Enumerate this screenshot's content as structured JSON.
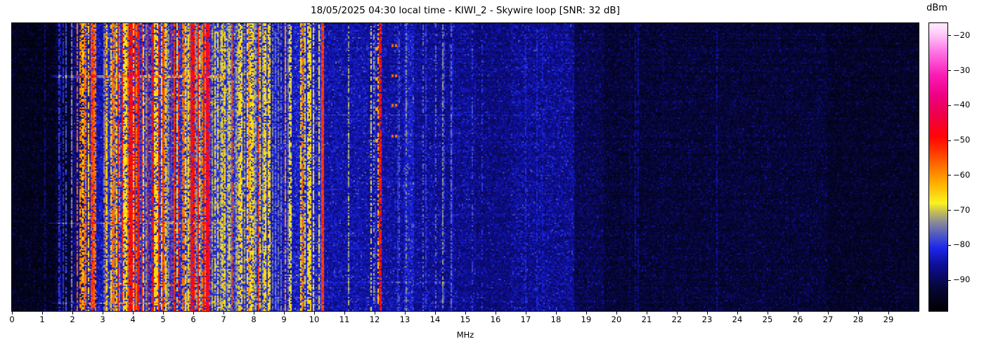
{
  "title": "18/05/2025 04:30 local time - KIWI_2 - Skywire loop [SNR: 32 dB]",
  "chart_data": {
    "type": "heatmap",
    "subtype": "radio-spectrum-waterfall",
    "title": "18/05/2025 04:30 local time - KIWI_2 - Skywire loop [SNR: 32 dB]",
    "xlabel": "MHz",
    "x_range_mhz": [
      0,
      30
    ],
    "x_ticks": [
      0,
      1,
      2,
      3,
      4,
      5,
      6,
      7,
      8,
      9,
      10,
      11,
      12,
      13,
      14,
      15,
      16,
      17,
      18,
      19,
      20,
      21,
      22,
      23,
      24,
      25,
      26,
      27,
      28,
      29
    ],
    "colorbar": {
      "unit": "dBm",
      "ticks": [
        -20,
        -30,
        -40,
        -50,
        -60,
        -70,
        -80,
        -90
      ],
      "range": [
        -98.9,
        -16.5
      ]
    },
    "colormap_stops": [
      [
        0.0,
        0,
        0,
        0
      ],
      [
        0.08,
        6,
        6,
        55
      ],
      [
        0.16,
        14,
        14,
        150
      ],
      [
        0.22,
        28,
        40,
        235
      ],
      [
        0.27,
        85,
        95,
        190
      ],
      [
        0.31,
        140,
        140,
        150
      ],
      [
        0.345,
        196,
        190,
        85
      ],
      [
        0.375,
        250,
        243,
        30
      ],
      [
        0.44,
        255,
        178,
        0
      ],
      [
        0.5,
        255,
        115,
        0
      ],
      [
        0.56,
        255,
        48,
        0
      ],
      [
        0.605,
        255,
        5,
        5
      ],
      [
        0.68,
        238,
        0,
        72
      ],
      [
        0.75,
        238,
        0,
        132
      ],
      [
        0.82,
        250,
        28,
        182
      ],
      [
        0.9,
        255,
        115,
        228
      ],
      [
        0.965,
        255,
        205,
        250
      ],
      [
        1.0,
        255,
        235,
        255
      ]
    ],
    "seed": 1337,
    "bands": [
      {
        "f0": 0.0,
        "f1": 1.45,
        "base": -95.5,
        "noise": 2.2,
        "d": 0.02,
        "mix": [
          [
            0.5,
            -86
          ],
          [
            1,
            -80
          ]
        ],
        "sparkle": [
          0.1,
          5
        ]
      },
      {
        "f0": 1.45,
        "f1": 1.95,
        "base": -93.5,
        "noise": 2.8,
        "d": 0.1,
        "mix": [
          [
            0.35,
            -78
          ],
          [
            0.75,
            -84
          ],
          [
            1,
            -87
          ]
        ],
        "sparkle": [
          0.1,
          5
        ]
      },
      {
        "f0": 1.95,
        "f1": 2.35,
        "base": -88.5,
        "noise": 3.5,
        "d": 0.38,
        "mix": [
          [
            0.15,
            -58
          ],
          [
            0.42,
            -65
          ],
          [
            0.72,
            -74
          ],
          [
            1,
            -81
          ]
        ],
        "sparkle": [
          0.08,
          6
        ]
      },
      {
        "f0": 2.35,
        "f1": 2.78,
        "base": -83.0,
        "noise": 4.5,
        "d": 0.58,
        "mix": [
          [
            0.14,
            -52
          ],
          [
            0.38,
            -58
          ],
          [
            0.74,
            -66
          ],
          [
            1,
            -74
          ]
        ],
        "sparkle": [
          0.07,
          8
        ]
      },
      {
        "f0": 2.78,
        "f1": 3.08,
        "base": -84.5,
        "noise": 4.0,
        "d": 0.25,
        "mix": [
          [
            0.2,
            -58
          ],
          [
            0.6,
            -67
          ],
          [
            1,
            -75
          ]
        ],
        "sparkle": [
          0.06,
          7
        ]
      },
      {
        "f0": 3.08,
        "f1": 4.75,
        "base": -81.0,
        "noise": 4.5,
        "d": 0.78,
        "mix": [
          [
            0.27,
            -50
          ],
          [
            0.52,
            -58
          ],
          [
            0.8,
            -66
          ],
          [
            1,
            -73
          ]
        ],
        "sparkle": [
          0.08,
          8
        ]
      },
      {
        "f0": 4.75,
        "f1": 5.65,
        "base": -81.0,
        "noise": 4.5,
        "d": 0.68,
        "mix": [
          [
            0.16,
            -51
          ],
          [
            0.4,
            -59
          ],
          [
            0.78,
            -66
          ],
          [
            1,
            -73
          ]
        ],
        "sparkle": [
          0.08,
          8
        ]
      },
      {
        "f0": 5.65,
        "f1": 6.6,
        "base": -81.0,
        "noise": 4.5,
        "d": 0.78,
        "mix": [
          [
            0.3,
            -49
          ],
          [
            0.55,
            -58
          ],
          [
            0.84,
            -66
          ],
          [
            1,
            -73
          ]
        ],
        "sparkle": [
          0.08,
          8
        ]
      },
      {
        "f0": 6.6,
        "f1": 7.5,
        "base": -80.0,
        "noise": 4.5,
        "d": 0.74,
        "mix": [
          [
            0.08,
            -52
          ],
          [
            0.3,
            -59
          ],
          [
            0.66,
            -66
          ],
          [
            1,
            -72
          ]
        ],
        "sparkle": [
          0.1,
          7
        ]
      },
      {
        "f0": 7.5,
        "f1": 8.55,
        "base": -80.5,
        "noise": 4.5,
        "d": 0.62,
        "mix": [
          [
            0.05,
            -54
          ],
          [
            0.2,
            -60
          ],
          [
            0.62,
            -66
          ],
          [
            1,
            -72
          ]
        ],
        "sparkle": [
          0.1,
          7
        ]
      },
      {
        "f0": 8.55,
        "f1": 9.35,
        "base": -83.5,
        "noise": 4.0,
        "d": 0.25,
        "mix": [
          [
            0.12,
            -60
          ],
          [
            0.5,
            -68
          ],
          [
            1,
            -75
          ]
        ],
        "sparkle": [
          0.08,
          6
        ]
      },
      {
        "f0": 9.35,
        "f1": 10.18,
        "base": -82.5,
        "noise": 4.0,
        "d": 0.55,
        "mix": [
          [
            0.12,
            -57
          ],
          [
            0.58,
            -66
          ],
          [
            1,
            -74
          ]
        ],
        "sparkle": [
          0.08,
          6
        ]
      },
      {
        "f0": 10.18,
        "f1": 10.32,
        "base": -80.0,
        "noise": 3.5,
        "d": 0.0,
        "mix": [
          [
            1,
            -80
          ]
        ],
        "sparkle": [
          0.05,
          5
        ]
      },
      {
        "f0": 10.32,
        "f1": 12.28,
        "base": -85.0,
        "noise": 3.2,
        "d": 0.05,
        "mix": [
          [
            0.4,
            -72
          ],
          [
            1,
            -79
          ]
        ],
        "sparkle": [
          0.09,
          5
        ]
      },
      {
        "f0": 12.28,
        "f1": 13.0,
        "base": -85.5,
        "noise": 3.2,
        "d": 0.05,
        "mix": [
          [
            0.3,
            -73
          ],
          [
            1,
            -80
          ]
        ],
        "sparkle": [
          0.09,
          5
        ]
      },
      {
        "f0": 13.0,
        "f1": 13.3,
        "base": -83.0,
        "noise": 3.4,
        "d": 0.12,
        "mix": [
          [
            0.4,
            -74
          ],
          [
            1,
            -79
          ]
        ],
        "sparkle": [
          0.12,
          5
        ]
      },
      {
        "f0": 13.3,
        "f1": 14.3,
        "base": -86.0,
        "noise": 3.2,
        "d": 0.05,
        "mix": [
          [
            0.35,
            -74
          ],
          [
            1,
            -80
          ]
        ],
        "sparkle": [
          0.08,
          5
        ]
      },
      {
        "f0": 14.3,
        "f1": 15.35,
        "base": -86.5,
        "noise": 3.3,
        "d": 0.035,
        "mix": [
          [
            0.4,
            -76
          ],
          [
            1,
            -82
          ]
        ],
        "sparkle": [
          0.09,
          4.5
        ]
      },
      {
        "f0": 15.35,
        "f1": 16.5,
        "base": -87.5,
        "noise": 3.2,
        "d": 0.03,
        "mix": [
          [
            0.5,
            -78
          ],
          [
            1,
            -82
          ]
        ],
        "sparkle": [
          0.08,
          4.5
        ]
      },
      {
        "f0": 16.5,
        "f1": 18.62,
        "base": -86.5,
        "noise": 3.5,
        "d": 0.04,
        "mix": [
          [
            0.5,
            -79
          ],
          [
            1,
            -82
          ]
        ],
        "sparkle": [
          0.12,
          4.5
        ]
      },
      {
        "f0": 18.62,
        "f1": 19.6,
        "base": -91.0,
        "noise": 3.0,
        "d": 0.015,
        "mix": [
          [
            1,
            -84
          ]
        ],
        "sparkle": [
          0.12,
          4.5
        ]
      },
      {
        "f0": 19.6,
        "f1": 27.0,
        "base": -93.0,
        "noise": 2.8,
        "d": 0.012,
        "mix": [
          [
            1,
            -86
          ]
        ],
        "sparkle": [
          0.12,
          4.5
        ]
      },
      {
        "f0": 27.0,
        "f1": 30.2,
        "base": -94.2,
        "noise": 2.5,
        "d": 0.01,
        "mix": [
          [
            1,
            -87
          ]
        ],
        "sparkle": [
          0.1,
          4.5
        ]
      }
    ],
    "lines": [
      {
        "f": 1.1,
        "w": 1,
        "v": -87,
        "fl": 0.4,
        "vary": 3
      },
      {
        "f": 1.58,
        "w": 1,
        "v": -79,
        "fl": 0.35,
        "vary": 3
      },
      {
        "f": 1.72,
        "w": 1,
        "v": -80,
        "fl": 0.3,
        "vary": 3
      },
      {
        "f": 2.16,
        "w": 2,
        "v": -57,
        "fl": 0.3,
        "vary": 6
      },
      {
        "f": 2.24,
        "w": 2,
        "v": -60,
        "fl": 0.35,
        "vary": 6
      },
      {
        "f": 2.615,
        "w": 3,
        "v": -54,
        "fl": 0.08,
        "vary": 7
      },
      {
        "f": 2.7,
        "w": 2,
        "v": -57,
        "fl": 0.15,
        "vary": 7
      },
      {
        "f": 3.93,
        "w": 3,
        "v": -49,
        "fl": 0.1,
        "vary": 6
      },
      {
        "f": 4.18,
        "w": 3,
        "v": -50,
        "fl": 0.12,
        "vary": 6
      },
      {
        "f": 4.47,
        "w": 2,
        "v": -51,
        "fl": 0.12,
        "vary": 6
      },
      {
        "f": 5.0,
        "w": 2,
        "v": -52,
        "fl": 0.15,
        "vary": 6
      },
      {
        "f": 5.36,
        "w": 2,
        "v": -53,
        "fl": 0.15,
        "vary": 6
      },
      {
        "f": 5.95,
        "w": 3,
        "v": -49,
        "fl": 0.1,
        "vary": 6
      },
      {
        "f": 6.15,
        "w": 2,
        "v": -50,
        "fl": 0.12,
        "vary": 6
      },
      {
        "f": 6.42,
        "w": 3,
        "v": -46,
        "fl": 0.1,
        "vary": 9
      },
      {
        "f": 6.53,
        "w": 2,
        "v": -50,
        "fl": 0.15,
        "vary": 7
      },
      {
        "f": 7.3,
        "w": 2,
        "v": -55,
        "fl": 0.2,
        "vary": 7
      },
      {
        "f": 9.62,
        "w": 2,
        "v": -58,
        "fl": 0.25,
        "vary": 6
      },
      {
        "f": 10.24,
        "w": 3,
        "v": -53,
        "fl": 0.05,
        "vary": 5
      },
      {
        "f": 11.89,
        "w": 1,
        "v": -69,
        "fl": 0.45,
        "vary": 5
      },
      {
        "f": 11.97,
        "w": 1,
        "v": -72,
        "fl": 0.5,
        "vary": 4
      },
      {
        "f": 12.11,
        "w": 2,
        "v": -64,
        "fl": 0.5,
        "vary": 6
      },
      {
        "f": 12.16,
        "w": 4,
        "v": -50,
        "fl": 0.18,
        "vary": 8
      },
      {
        "f": 12.82,
        "w": 1,
        "v": -77,
        "fl": 0.55,
        "vary": 3
      },
      {
        "f": 13.05,
        "w": 1,
        "v": -74,
        "fl": 0.5,
        "vary": 3
      },
      {
        "f": 13.6,
        "w": 1,
        "v": -76,
        "fl": 0.55,
        "vary": 3
      },
      {
        "f": 14.0,
        "w": 2,
        "v": -76,
        "fl": 0.55,
        "vary": 3
      },
      {
        "f": 14.32,
        "w": 1,
        "v": -79,
        "fl": 0.6,
        "vary": 3
      },
      {
        "f": 15.25,
        "w": 1,
        "v": -78,
        "fl": 0.55,
        "vary": 3
      },
      {
        "f": 15.55,
        "w": 1,
        "v": -80,
        "fl": 0.6,
        "vary": 3
      },
      {
        "f": 17.0,
        "w": 1,
        "v": -81,
        "fl": 0.5,
        "vary": 3
      },
      {
        "f": 17.38,
        "w": 1,
        "v": -81,
        "fl": 0.5,
        "vary": 3
      },
      {
        "f": 17.56,
        "w": 1,
        "v": -82,
        "fl": 0.55,
        "vary": 3
      },
      {
        "f": 19.05,
        "w": 1,
        "v": -88,
        "fl": 0.6,
        "vary": 2
      },
      {
        "f": 20.42,
        "w": 1,
        "v": -88.5,
        "fl": 0.6,
        "vary": 2
      },
      {
        "f": 21.55,
        "w": 1,
        "v": -89,
        "fl": 0.65,
        "vary": 2
      },
      {
        "f": 24.9,
        "w": 1,
        "v": -89,
        "fl": 0.65,
        "vary": 2
      }
    ],
    "marks": [
      {
        "f": 12.02,
        "w": 4,
        "h": 5,
        "v": -62,
        "ys": [
          34,
          77,
          120,
          165
        ]
      },
      {
        "f": 12.56,
        "w": 3,
        "h": 4,
        "v": -57,
        "ys": [
          30,
          73,
          115,
          159
        ]
      },
      {
        "f": 12.67,
        "w": 3,
        "h": 4,
        "v": -58,
        "ys": [
          30,
          73,
          115,
          159
        ]
      }
    ],
    "streaks": [
      {
        "y": 74,
        "h": 3,
        "f0": 1.3,
        "f1": 7.05,
        "boost": 9
      },
      {
        "y": 283,
        "h": 3,
        "f0": 1.2,
        "f1": 7.0,
        "boost": 8
      },
      {
        "y": 130,
        "h": 2,
        "f0": 10.3,
        "f1": 17.5,
        "boost": 3.5
      },
      {
        "y": 397,
        "h": 3,
        "f0": 1.3,
        "f1": 7.0,
        "boost": 6
      },
      {
        "y": 368,
        "h": 2,
        "f0": 10.3,
        "f1": 14.5,
        "boost": 3
      }
    ]
  }
}
